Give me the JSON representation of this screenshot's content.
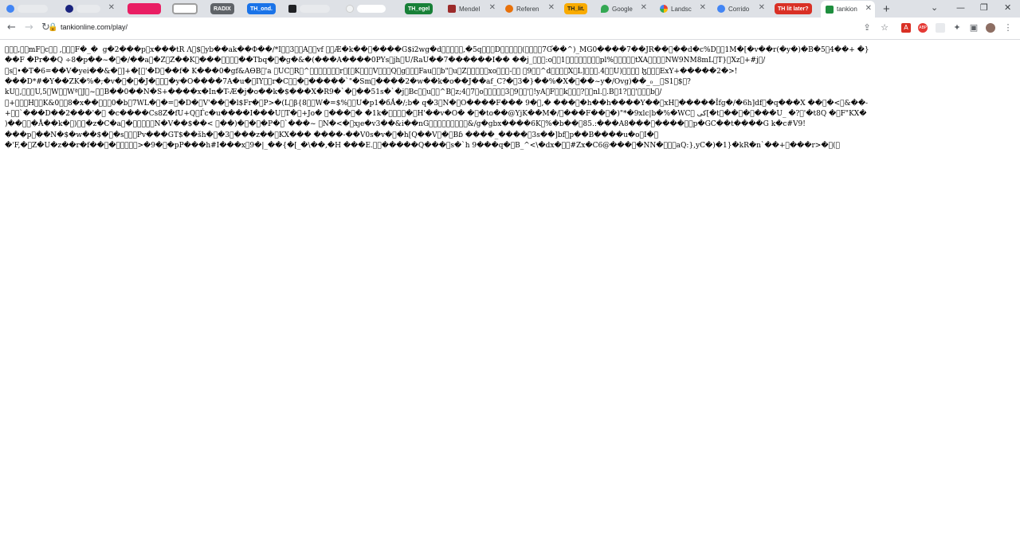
{
  "tabs": [
    {
      "label": "",
      "favicon": "google-icon",
      "color": "#4285f4"
    },
    {
      "label": "",
      "favicon": "hm-logo-icon",
      "color": "#1a237e"
    },
    {
      "label": "",
      "favicon": "bookmark-pill-icon",
      "color": "#e91e63"
    },
    {
      "label": "",
      "favicon": "bookmark-pill-icon",
      "color": "#9e9e9e"
    },
    {
      "label": "RADIX",
      "favicon": "",
      "color": "#5f6368"
    },
    {
      "label": "TH_ond.",
      "favicon": "",
      "color": "#1a73e8"
    },
    {
      "label": "",
      "favicon": "page-icon",
      "color": "#202124"
    },
    {
      "label": "",
      "favicon": "page-icon",
      "color": "#e0e0e0"
    },
    {
      "label": "TH_egel",
      "favicon": "",
      "color": "#188038"
    },
    {
      "label": "Mendel",
      "favicon": "mendeley-icon",
      "color": "#9c2a2a"
    },
    {
      "label": "Referen",
      "favicon": "reference-icon",
      "color": "#e8710a"
    },
    {
      "label": "TH_lit.",
      "favicon": "",
      "color": "#f9ab00"
    },
    {
      "label": "Google",
      "favicon": "maps-pin-icon",
      "color": "#34a853"
    },
    {
      "label": "Landsc",
      "favicon": "photos-icon",
      "color": "#ea4335"
    },
    {
      "label": "Corrido",
      "favicon": "google-icon",
      "color": "#4285f4"
    },
    {
      "label": "TH lit later?",
      "favicon": "",
      "color": "#d93025"
    },
    {
      "label": "tankion",
      "favicon": "tanki-icon",
      "color": "#1e8e3e"
    }
  ],
  "address": {
    "url": "tankionline.com/play/"
  },
  "page_text": "\u0000\u0000\u0000,\u0000\u0000mF\u0000c\u0000\u0000 ,\u0000\u0000\u0000F�_�  g�2���p\u0000x���tR Λ\u0000$\u0000yb��ak��Φ��/*I\u0000\u00003\u0000\u0000A\u0000\u0000vf \u0000\u0000Ǽ�k��\u0000����G$i2wg�d\u0000\u0000\u0000\u0000\u0000,�5q\u0000\u0000\u0000D\u0000\u0000\u0000\u0000\u0000(\u0000\u0000\u0000\u00007Ɠ��^)_MG0����7��JR��\u0000��d�c%D\u0000\u00001M�[�v��r(�y�)�B�5\u00004��+ �}\n��F �Pr��Q ÷8�p��~�\u0000�/��a\u0000�Z\u0000Z��K\u0000���\u0000\u0000\u0000\u0000��Tbq�\u0000�g�&�(���A����0PYs\u0000jh\u0000U/RaU��7������I�� ��j_\u0000\u0000\u0000:o\u0000\u00001\u0000\u0000\u0000\u0000\u0000\u0000\u0000\u0000pl%\u0000\u0000\u0000\u0000\u0000tXA\u0000\u0000\u0000\u0000NW9NM8mL\u0000T}\u0000Xz\u0000+#j\u0000/\n\u0000s\u0000•�T�6=��V�yei��&�\u0000]+�[\u0000'�D\u0000��f� K���0�gf&AѲB\u0000'а \u0000UC\u0000R\u0000^\u0000\u0000\u0000\u0000\u0000\u0000\u0000r\u0000[\u0000K\u0000\u0000\u0000V\u0000\u0000\u0000Q\u0000g\u0000\u0000\u0000Fau\u0000\u0000b\"\u0000u\u0000Z\u0000\u0000\u0000\u0000\u0000xo\u0000\u0000\u0000-\u0000\u0000 \u00009\u0000\u0000^d\u0000\u0000\u0000\u0000X\u0000L]\u0000\u0000\u0000.4\u0000\u0000U)\u0000\u0000\u0000\u0000 ɮ\u0000\u0000\u0000ExY+�����2�>!\n���D*#�Y��ZK�%�;�v�\u0000�\u0000�J�\u0000\u0000\u0000�y�O����7A�u�\u0000IY\u0000\u0000r�C\u0000\u0000�\u0000�����`\"�Sm\u0000����2�w��k�o��J��af_C?�\u00003�}��%�X�\u0000��~y�/Ovg)��_₀__\u0000S1\u0000$\u0000?\nkU\u0000,\u0000\u0000\u0000U,5\u0000W\u0000\u0000Wª\u0000J\u0000~\u0000\u0000B��0��N�S+����x�In�T-Æ�j�o��k�$���X�R9�`�\u0000��51s�`�j\u0000Bc\u0000\u0000u\u0000\u0000^B\u0000z;4\u00007\u0000o\u0000\u0000\u0000\u0000\u00003\u00009\u0000\u0000'\u0000!yA\u0000F\u0000\u0000k\u0000\u0000\u0000?\u0000\u0000nl.\u0000.B\u00001?\u0000\u0000'\u0000\u0000\u0000b\u0000/\n\u0000+\u0000\u0000\u0000H\u0000\u0000K&0\u0000\u00008�x��\u0000\u0000\u00000�b\u00007WL�\u0000�=\u0000�D�\u0000V'��\u0000�l$Fr�\u0000P>�(L\u0000β{8\u0000\u0000W�=$%\u0000\u0000U�p1�бǺ�/;b� q�3\u0000N�\u0000O����F��� 9�\u0000,� ���\u0000�h��h����Y��\u0000xH\u0000�����Îfg�/�6h]df\u0000�q���X ��\u0000�<\u0000&��-\n+\u0000\u0000`���D��2���'�\u0000 �c����Cs8Z�fU+Q\u0000Ѓc�u����I���U\u0000Т�\u0000+Jo� \u0000���\u0000� �1k�\u0000\u0000\u0000\u0000�\u0000H'��v�O� �\u0000�to��@YjK��M�/\u0000���F��\u0000�)\"*�9xlc|b�%�WC\u0000 كی[�t\u0000��\u0000�\u0000���U_ �?\u0000'�t8Q �\u0000F\"KX�\n)��\u0000\u0000�Å��k�\u0000)\u0000\u0000�z�C�a\u0000�\u0000\u0000\u0000\u0000\u0000N�V��$��< \u0000��)�\u0000�\u0000�P�\u0000`���~ \u0000N�<�\u0000xȷe�v3��&i��nG\u0000\u0000\u0000\u0000\u0000\u0000\u0000\u0000\u0000&/g�gbx����6K\u0000%�b��\u000085.:���A8���\u0000����\u0000\u0000p�GC��t����G k�c#V9!\n���p\u0000��N�$�w��$�\u0000�s\u0000\u0000\u0000Pv���GT$��šh�\u0000�3\u0000���z��\u0000KX��� ����-��V0s�v�\u0000�h[Q��V\u0000�\u0000Bɓ ����_����\u00003s��]bf\u0000p��B����u�o\u0000I�\u0000\n�'F,�\u0000Z�U�z��r�f��\u0000�\u0000\u0000\u0000\u0000\u0000>�9�\u0000�pP���h#I���x\u00009�|_��{�[_�\\��,�H ���E.\u0000\u0000�����Q���\u0000s�`h 9���q�\u0000B_^<\\�dx�\u0000\u0000#Zx�C6@���\u0000�NN�\u0000\u0000\u0000aQ:},yC�)�1}�kR�n`��+\u0000���r>�\u0000(\u0000",
  "accent": {
    "tabstrip": "#dee1e6",
    "url_text": "#202124"
  }
}
